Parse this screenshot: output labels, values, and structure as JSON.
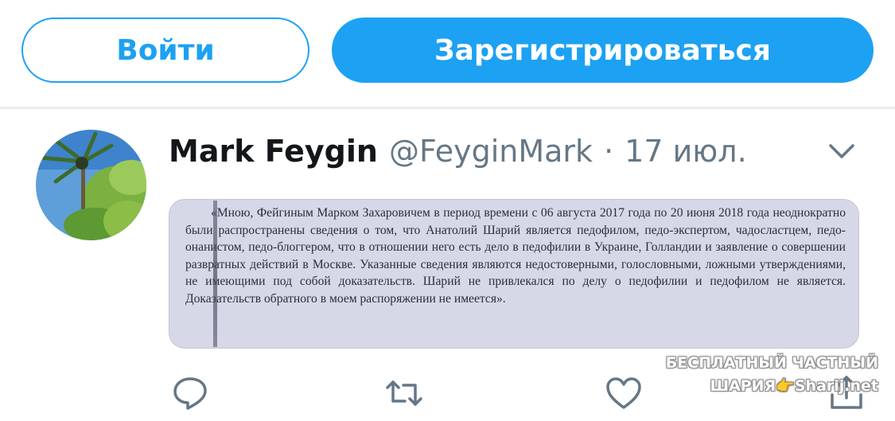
{
  "auth": {
    "login_label": "Войти",
    "signup_label": "Зарегистрироваться"
  },
  "tweet": {
    "display_name": "Mark Feygin",
    "handle": "@FeyginMark",
    "separator": "·",
    "time": "17 июл.",
    "document_text": "«Мною, Фейгиным Марком Захаровичем в период времени с 06 августа 2017 года по 20 июня 2018 года неоднократно были распространены сведения о том, что Анатолий Шарий является педофилом, педо-экспертом, чадосластцем, педо-онанистом, педо-блоггером, что в отношении него есть дело в педофилии в Украине, Голландии и заявление о совершении развратных действий в Москве. Указанные сведения являются недостоверными, голословными, ложными утверждениями, не имеющими под собой доказательств. Шарий не привлекался по делу о педофилии и педофилом не является. Доказательств обратного в моем распоряжении не имеется»."
  },
  "icons": {
    "reply": "reply-icon",
    "retweet": "retweet-icon",
    "like": "heart-icon",
    "share": "share-icon",
    "more": "chevron-down-icon"
  },
  "watermark": {
    "line1": "БЕСПЛАТНЫЙ ЧАСТНЫЙ",
    "line2": "ШАРИЯ👉Sharij.net"
  },
  "colors": {
    "accent": "#1da1f2",
    "text": "#14171a",
    "muted": "#657786"
  }
}
